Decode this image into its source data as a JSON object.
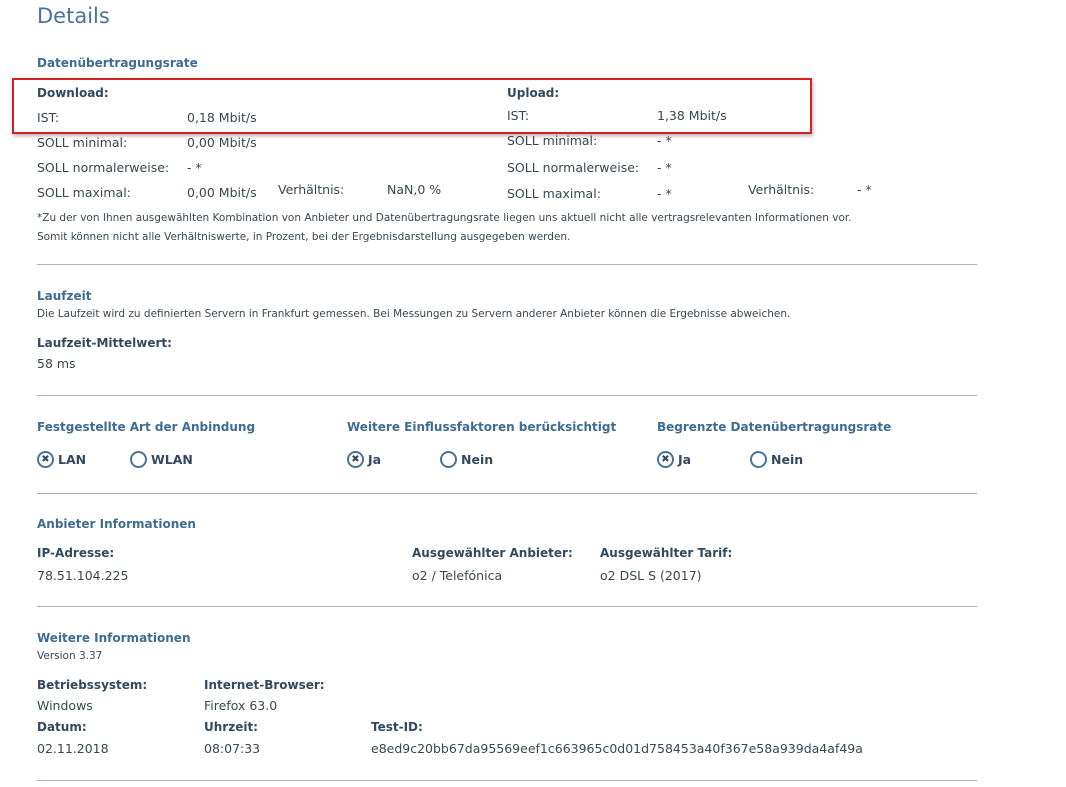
{
  "title": "Details",
  "rate": {
    "heading": "Datenübertragungsrate",
    "download": {
      "label": "Download:",
      "ist_l": "IST:",
      "ist": "0,18 Mbit/s",
      "min_l": "SOLL minimal:",
      "min": "0,00 Mbit/s",
      "norm_l": "SOLL normalerweise:",
      "norm": "- *",
      "max_l": "SOLL maximal:",
      "max": "0,00 Mbit/s",
      "ratio_l": "Verhältnis:",
      "ratio": "NaN,0 %"
    },
    "upload": {
      "label": "Upload:",
      "ist_l": "IST:",
      "ist": "1,38 Mbit/s",
      "min_l": "SOLL minimal:",
      "min": "- *",
      "norm_l": "SOLL normalerweise:",
      "norm": "- *",
      "max_l": "SOLL maximal:",
      "max": "- *",
      "ratio_l": "Verhältnis:",
      "ratio": "- *"
    },
    "note1": "*Zu der von Ihnen ausgewählten Kombination von Anbieter und Datenübertragungsrate liegen uns aktuell nicht alle vertragsrelevanten Informationen vor.",
    "note2": "Somit können nicht alle Verhältniswerte, in Prozent, bei der Ergebnisdarstellung ausgegeben werden."
  },
  "latency": {
    "heading": "Laufzeit",
    "desc": "Die Laufzeit wird zu definierten Servern in Frankfurt gemessen. Bei Messungen zu Servern anderer Anbieter können die Ergebnisse abweichen.",
    "mean_l": "Laufzeit-Mittelwert:",
    "mean": "58 ms"
  },
  "options": [
    {
      "heading": "Festgestellte Art der Anbindung",
      "a": "LAN",
      "b": "WLAN",
      "mark": "✖"
    },
    {
      "heading": "Weitere Einflussfaktoren berücksichtigt",
      "a": "Ja",
      "b": "Nein",
      "mark": "✖"
    },
    {
      "heading": "Begrenzte Datenübertragungsrate",
      "a": "Ja",
      "b": "Nein",
      "mark": "✖"
    }
  ],
  "provider": {
    "heading": "Anbieter Informationen",
    "ip_l": "IP-Adresse:",
    "ip": "78.51.104.225",
    "prov_l": "Ausgewählter Anbieter:",
    "prov": "o2 / Telefónica",
    "tarif_l": "Ausgewählter Tarif:",
    "tarif": "o2 DSL S (2017)"
  },
  "more": {
    "heading": "Weitere Informationen",
    "version": "Version 3.37",
    "os_l": "Betriebssystem:",
    "os": "Windows",
    "br_l": "Internet-Browser:",
    "br": "Firefox 63.0",
    "date_l": "Datum:",
    "date": "02.11.2018",
    "time_l": "Uhrzeit:",
    "time": "08:07:33",
    "id_l": "Test-ID:",
    "id": "e8ed9c20bb67da95569eef1c663965c0d01d758453a40f367e58a939da4af49a"
  }
}
